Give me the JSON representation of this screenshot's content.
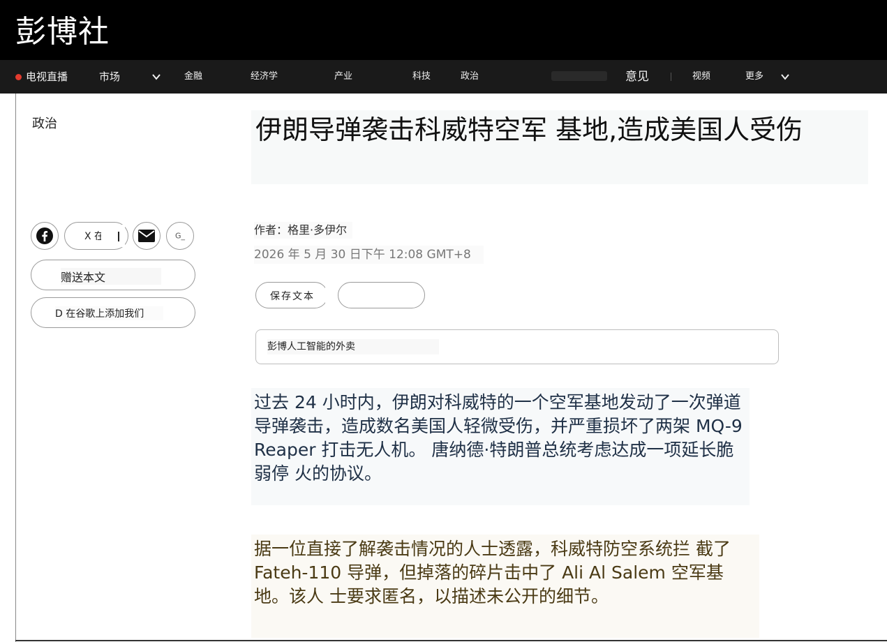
{
  "site": {
    "logo": "彭博社"
  },
  "nav": {
    "live": "电视直播",
    "markets": "市场",
    "finance": "金融",
    "economics": "经济学",
    "industry": "产业",
    "tech": "科技",
    "politics": "政治",
    "opinion": "意见",
    "video": "视频",
    "more": "更多"
  },
  "article": {
    "section": "政治",
    "title": "伊朗导弹袭击科威特空军 基地,造成美国人受伤",
    "author": "作者：格里·多伊尔",
    "date": "2026 年 5 月 30 日下午 12:08 GMT+8",
    "paragraphs": [
      "过去 24 小时内，伊朗对科威特的一个空军基地发动了一次弹道导弹袭击，造成数名美国人轻微受伤，并严重损坏了两架 MQ-9 Reaper 打击无人机。 唐纳德·特朗普总统考虑达成一项延长脆弱停 火的协议。",
      "据一位直接了解袭击情况的人士透露，科威特防空系统拦 截了 Fateh-110 导弹，但掉落的碎片击中了  Ali Al Salem 空军基地。该人 士要求匿名，以描述未公开的细节。"
    ]
  },
  "share": {
    "x_label": "X 在",
    "gift_label": "赠送本文",
    "google_label": "D 在谷歌上添加我们",
    "g_label": "G_"
  },
  "actions": {
    "save_label": "保存文本",
    "second_label": ""
  },
  "ai_summary": {
    "label": "彭博人工智能的外卖"
  },
  "colors": {
    "live_dot": "#e23b2e",
    "topbar": "#000000",
    "navbar": "#1a1a1a"
  }
}
